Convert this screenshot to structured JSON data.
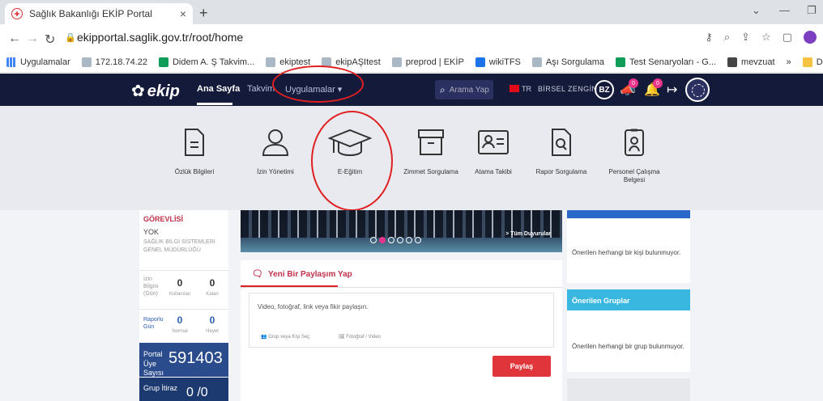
{
  "browser": {
    "tab_title": "Sağlık Bakanlığı EKİP Portal",
    "tab_close": "×",
    "new_tab": "+",
    "url": "ekipportal.saglik.gov.tr/root/home",
    "bookmarks": [
      {
        "label": "Uygulamalar",
        "icon": "apps-grid-icon"
      },
      {
        "label": "172.18.74.22",
        "icon": "page-icon"
      },
      {
        "label": "Didem A. Ş Takvim...",
        "icon": "calendar-icon"
      },
      {
        "label": "ekiptest",
        "icon": "page-icon"
      },
      {
        "label": "ekipAŞItest",
        "icon": "page-icon"
      },
      {
        "label": "preprod | EKİP",
        "icon": "page-icon"
      },
      {
        "label": "wikiTFS",
        "icon": "tfs-icon"
      },
      {
        "label": "Aşı Sorgulama",
        "icon": "page-icon"
      },
      {
        "label": "Test Senaryoları - G...",
        "icon": "calendar-icon"
      },
      {
        "label": "mevzuat",
        "icon": "globe-icon"
      },
      {
        "label": "»",
        "icon": ""
      },
      {
        "label": "Diğer yer i",
        "icon": "folder-icon"
      }
    ]
  },
  "navbar": {
    "logo": "ekip",
    "links": [
      "Ana Sayfa",
      "Takvim",
      "Uygulamalar ▾"
    ],
    "search_placeholder": "Arama Yap",
    "lang": "TR",
    "user_name": "BİRSEL ZENGİN",
    "avatar_initials": "BZ",
    "announcement_count": "0",
    "notification_count": "0"
  },
  "megamenu": {
    "items": [
      {
        "label": "Özlük Bilgileri",
        "icon": "document-icon"
      },
      {
        "label": "İzin Yönetimi",
        "icon": "user-icon"
      },
      {
        "label": "E-Eğitim",
        "icon": "graduation-cap-icon"
      },
      {
        "label": "Zimmet Sorgulama",
        "icon": "archive-box-icon"
      },
      {
        "label": "Atama Takibi",
        "icon": "id-card-icon"
      },
      {
        "label": "Rapor Sorgulama",
        "icon": "report-search-icon"
      },
      {
        "label": "Personel Çalışma Belgesi",
        "icon": "badge-icon"
      }
    ]
  },
  "profile": {
    "role": "GÖREVLİSİ",
    "role_line2": "YOK",
    "department": "SAĞLIK BİLGİ SİSTEMLERİ GENEL MÜDÜRLÜĞÜ",
    "leave_label": "İzin Bilgisi (Gün)",
    "leave_used": "0",
    "leave_used_label": "Kullanılan",
    "leave_left": "0",
    "leave_left_label": "Kalan",
    "report_label": "Raporlu Gün",
    "report_normal": "0",
    "report_normal_label": "Normal",
    "report_board": "0",
    "report_board_label": "Heyet",
    "portal_members_label": "Portal Üye Sayısı",
    "portal_members_value": "591403",
    "group_objection_label": "Grup İtiraz",
    "group_objection_value": "0 /0"
  },
  "banner": {
    "all_announcements": "> Tüm Duyurular"
  },
  "share": {
    "tab_label": "Yeni Bir Paylaşım Yap",
    "placeholder": "Video, fotoğraf, link veya fikir paylaşın.",
    "option_group": "Grup veya Kişi Seç",
    "option_media": "Fotoğraf / Video",
    "button": "Paylaş"
  },
  "right": {
    "suggested_people_empty": "Önerilen herhangi bir kişi bulunmuyor.",
    "suggested_groups_title": "Önerilen Gruplar",
    "suggested_groups_empty": "Önerilen herhangi bir grup bulunmuyor."
  },
  "colors": {
    "navbar_bg": "#141a3a",
    "accent_red": "#e0353a",
    "menu_bg": "#e8eaf0",
    "portal_blue": "#2b4c8c",
    "groups_header": "#3ab7e0"
  }
}
